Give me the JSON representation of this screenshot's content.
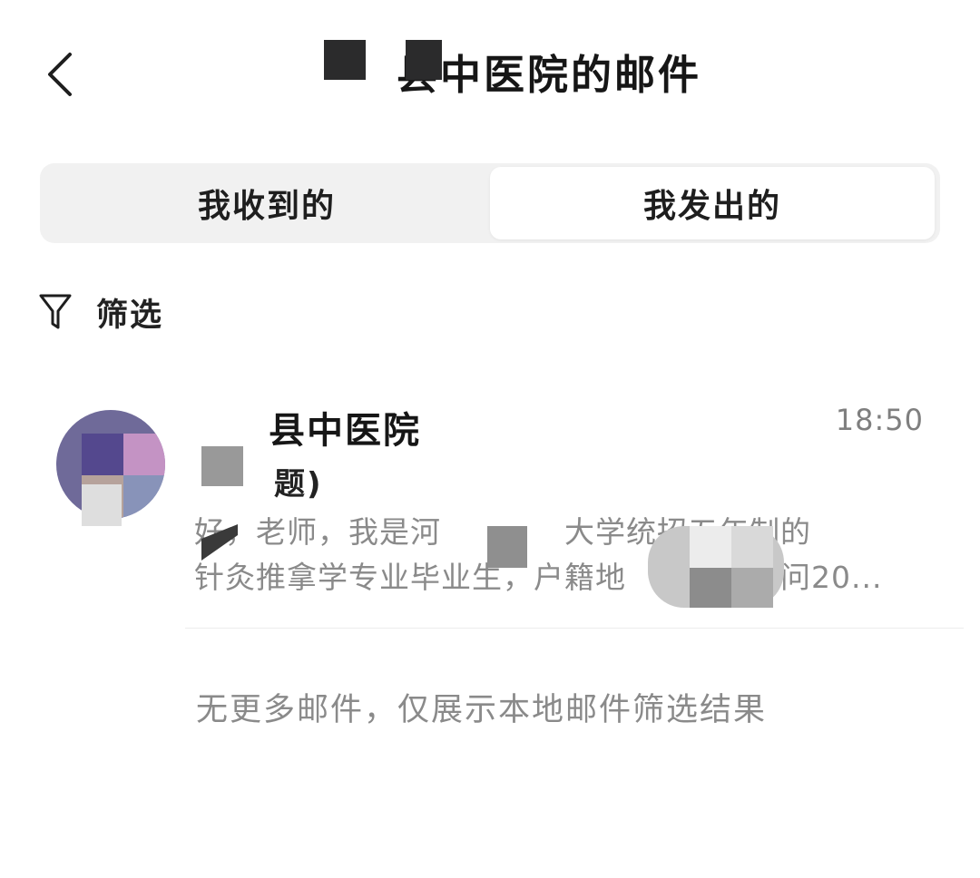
{
  "header": {
    "back_icon": "chevron-left-icon",
    "title": "县中医院的邮件"
  },
  "tabs": [
    {
      "label": "我收到的",
      "selected": false
    },
    {
      "label": "我发出的",
      "selected": true
    }
  ],
  "filter": {
    "icon": "funnel-icon",
    "label": "筛选"
  },
  "mail": [
    {
      "sender": "县中医院",
      "time": "18:50",
      "subject": "题)",
      "preview_line1": "好，老师，我是河　　　　大学统招五年制的",
      "preview_line2": "针灸推拿学专业毕业生，户籍地　　　　请问20..."
    }
  ],
  "footer": {
    "no_more_text": "无更多邮件，仅展示本地邮件筛选结果"
  },
  "colors": {
    "background": "#ffffff",
    "segment_bg": "#f1f1f1",
    "secondary_text": "#8a8a8a",
    "redaction": "#2b2b2c"
  }
}
